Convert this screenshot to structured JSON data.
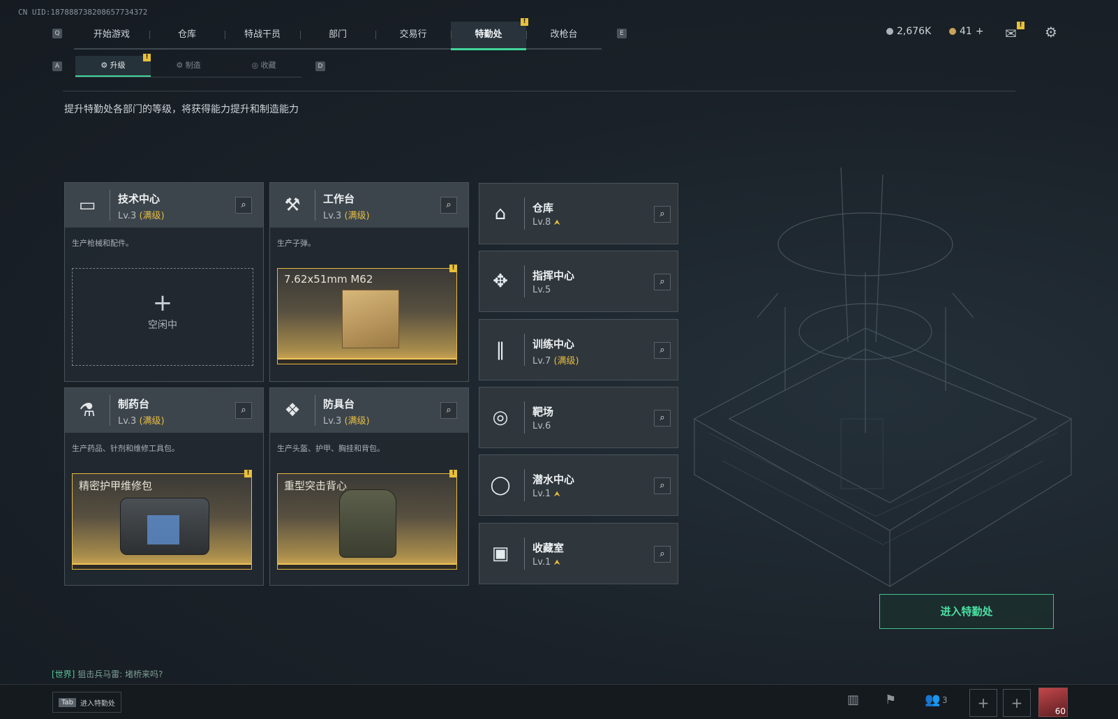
{
  "uid": "CN UID:187888738208657734372",
  "nav": {
    "key_left": "Q",
    "key_right": "E",
    "tabs": [
      "开始游戏",
      "仓库",
      "特战干员",
      "部门",
      "交易行",
      "特勤处",
      "改枪台"
    ],
    "active": "特勤处"
  },
  "currency": {
    "coins": "2,676K",
    "tokens": "41",
    "plus": "+"
  },
  "subnav": {
    "key_left": "A",
    "key_right": "D",
    "tabs": [
      "升级",
      "制造",
      "收藏"
    ],
    "active": "升级"
  },
  "description": "提升特勤处各部门的等级，将获得能力提升和制造能力",
  "stations": [
    {
      "name": "技术中心",
      "level": "Lv.3",
      "max": "(满级)",
      "info": "生产枪械和配件。",
      "slot_state": "空闲中",
      "slot_plus": "+"
    },
    {
      "name": "工作台",
      "level": "Lv.3",
      "max": "(满级)",
      "info": "生产子弹。",
      "product": "7.62x51mm M62"
    },
    {
      "name": "制药台",
      "level": "Lv.3",
      "max": "(满级)",
      "info": "生产药品、针剂和维修工具包。",
      "product": "精密护甲维修包"
    },
    {
      "name": "防具台",
      "level": "Lv.3",
      "max": "(满级)",
      "info": "生产头盔、护甲、胸挂和背包。",
      "product": "重型突击背心"
    }
  ],
  "departments": [
    {
      "name": "仓库",
      "level": "Lv.8",
      "upgradable": true,
      "max": ""
    },
    {
      "name": "指挥中心",
      "level": "Lv.5",
      "upgradable": false,
      "max": ""
    },
    {
      "name": "训练中心",
      "level": "Lv.7",
      "upgradable": false,
      "max": "(满级)"
    },
    {
      "name": "靶场",
      "level": "Lv.6",
      "upgradable": false,
      "max": ""
    },
    {
      "name": "潜水中心",
      "level": "Lv.1",
      "upgradable": true,
      "max": ""
    },
    {
      "name": "收藏室",
      "level": "Lv.1",
      "upgradable": true,
      "max": ""
    }
  ],
  "enter_button": "进入特勤处",
  "chat": {
    "channel": "[世界]",
    "message": "狙击兵马雷: 堵桥来吗?"
  },
  "bottom": {
    "tab_key": "Tab",
    "tab_label": "进入特勤处",
    "friends": "3",
    "player_level": "60"
  },
  "colors": {
    "accent": "#41d69a",
    "gold": "#e6bd43",
    "badge": "#e9c13a"
  }
}
